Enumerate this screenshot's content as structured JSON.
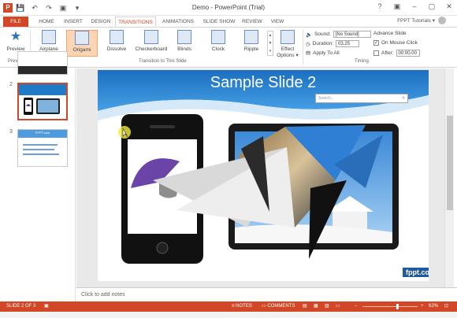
{
  "window": {
    "app_icon": "P",
    "title": "Demo - PowerPoint (Trial)",
    "qat_icons": [
      "save-icon",
      "undo-icon",
      "redo-icon",
      "slideshow-from-start-icon",
      "customize-qat-icon"
    ],
    "qat_glyphs": [
      "💾",
      "↶",
      "↷",
      "▣",
      "▾"
    ],
    "controls": [
      "?",
      "▣",
      "–",
      "▢",
      "✕"
    ],
    "account": "FPPT Tutorials ▾"
  },
  "tabs": [
    {
      "label": "FILE"
    },
    {
      "label": "HOME"
    },
    {
      "label": "INSERT"
    },
    {
      "label": "DESIGN"
    },
    {
      "label": "TRANSITIONS"
    },
    {
      "label": "ANIMATIONS"
    },
    {
      "label": "SLIDE SHOW"
    },
    {
      "label": "REVIEW"
    },
    {
      "label": "VIEW"
    }
  ],
  "ribbon": {
    "preview": {
      "label": "Preview",
      "group": "Preview"
    },
    "transitions": [
      {
        "label": "Airplane"
      },
      {
        "label": "Origami",
        "selected": true
      },
      {
        "label": "Dissolve"
      },
      {
        "label": "Checkerboard"
      },
      {
        "label": "Blinds"
      },
      {
        "label": "Clock"
      },
      {
        "label": "Ripple"
      }
    ],
    "transition_group_label": "Transition to This Slide",
    "effect_options": "Effect Options ▾",
    "timing": {
      "group_label": "Timing",
      "sound_label": "Sound:",
      "sound_value": "[No Sound]",
      "duration_label": "Duration:",
      "duration_value": "03.25",
      "apply_all": "Apply To All",
      "advance_label": "Advance Slide",
      "on_mouse_click": "On Mouse Click",
      "after_label": "After:",
      "after_value": "00:00.00"
    }
  },
  "slides_pane": {
    "numbers": [
      "2",
      "3"
    ],
    "slide3_title": "FPPT.com"
  },
  "slide": {
    "title": "Sample Slide 2",
    "search_placeholder": "Search...",
    "brand": "fppt.com"
  },
  "notes_placeholder": "Click to add notes",
  "statusbar": {
    "slide_info": "SLIDE 2 OF 3",
    "notes": "NOTES",
    "comments": "COMMENTS",
    "zoom": "62%",
    "zoom_level": 0.62
  },
  "colors": {
    "accent": "#d24726",
    "selected_transition": "#fcd5b4",
    "slide_blue": "#1f7ac8"
  }
}
